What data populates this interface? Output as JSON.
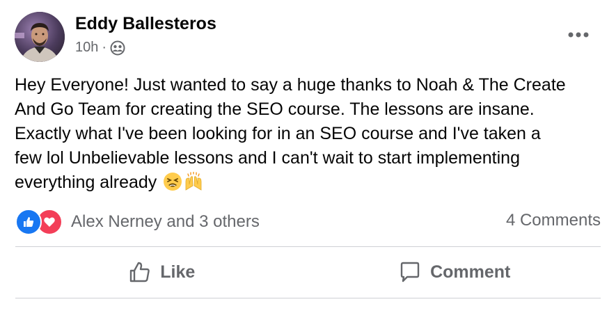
{
  "post": {
    "author": "Eddy Ballesteros",
    "time": "10h",
    "separator": "·",
    "audience_icon": "friends-audience-icon",
    "message_lines": [
      "Hey Everyone! Just wanted to say a huge thanks to Noah & The Create",
      "And Go Team for creating the SEO course. The lessons are insane.",
      "Exactly what I've been looking for in an SEO course and I've taken a",
      "few lol Unbelievable lessons and I can't wait to start implementing",
      "everything already"
    ],
    "emojis": [
      "😫",
      "🙌"
    ],
    "reactions": {
      "types": [
        "like",
        "love"
      ],
      "summary": "Alex Nerney and 3 others"
    },
    "comments_count": "4 Comments",
    "actions": {
      "like_label": "Like",
      "comment_label": "Comment"
    }
  },
  "colors": {
    "text_primary": "#050505",
    "text_secondary": "#65676b",
    "like_blue": "#1877f2",
    "love_red": "#f33e58",
    "divider": "#ced0d4"
  }
}
